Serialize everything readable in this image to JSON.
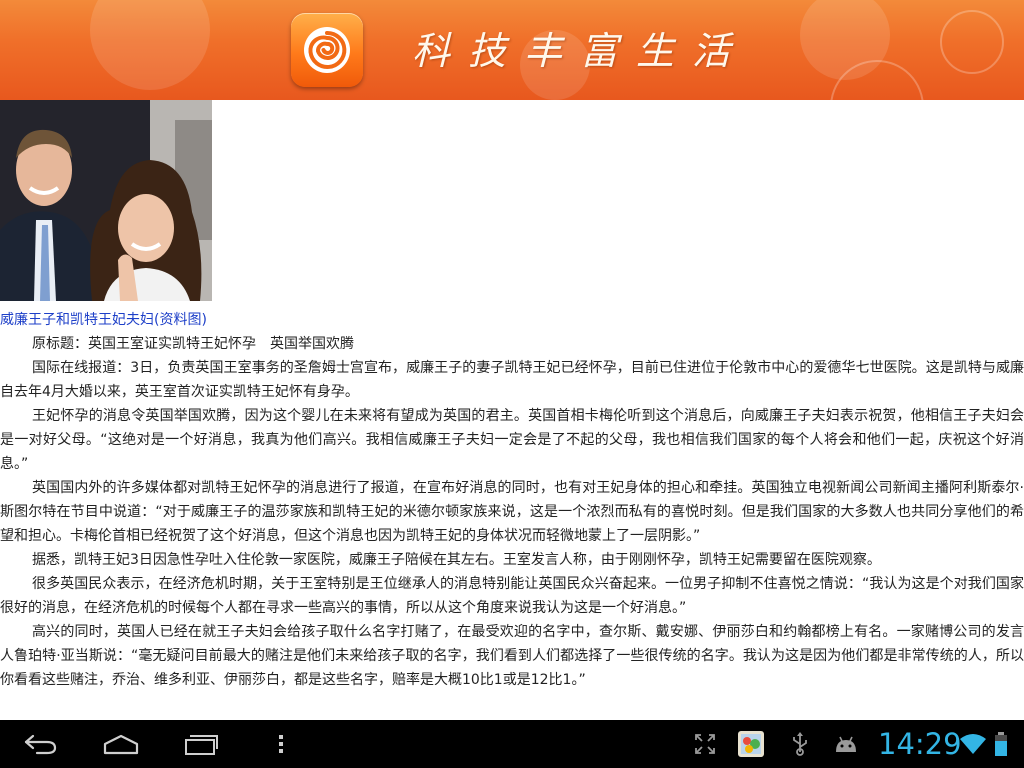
{
  "header": {
    "app_title": "科技丰富生活",
    "icons": {
      "logo": "swirl-logo-icon"
    },
    "colors": {
      "banner": "#f0702a",
      "logo": "#ff7a1a"
    }
  },
  "article": {
    "image_caption": "威廉王子和凯特王妃夫妇(资料图)",
    "paragraphs": [
      "原标题：英国王室证实凯特王妃怀孕　英国举国欢腾",
      "国际在线报道：3日，负责英国王室事务的圣詹姆士宫宣布，威廉王子的妻子凯特王妃已经怀孕，目前已住进位于伦敦市中心的爱德华七世医院。这是凯特与威廉自去年4月大婚以来，英王室首次证实凯特王妃怀有身孕。",
      "王妃怀孕的消息令英国举国欢腾，因为这个婴儿在未来将有望成为英国的君主。英国首相卡梅伦听到这个消息后，向威廉王子夫妇表示祝贺，他相信王子夫妇会是一对好父母。“这绝对是一个好消息，我真为他们高兴。我相信威廉王子夫妇一定会是了不起的父母，我也相信我们国家的每个人将会和他们一起，庆祝这个好消息。”",
      "英国国内外的许多媒体都对凯特王妃怀孕的消息进行了报道，在宣布好消息的同时，也有对王妃身体的担心和牵挂。英国独立电视新闻公司新闻主播阿利斯泰尔·斯图尔特在节目中说道：“对于威廉王子的温莎家族和凯特王妃的米德尔顿家族来说，这是一个浓烈而私有的喜悦时刻。但是我们国家的大多数人也共同分享他们的希望和担心。卡梅伦首相已经祝贺了这个好消息，但这个消息也因为凯特王妃的身体状况而轻微地蒙上了一层阴影。”",
      "据悉，凯特王妃3日因急性孕吐入住伦敦一家医院，威廉王子陪候在其左右。王室发言人称，由于刚刚怀孕，凯特王妃需要留在医院观察。",
      "很多英国民众表示，在经济危机时期，关于王室特别是王位继承人的消息特别能让英国民众兴奋起来。一位男子抑制不住喜悦之情说：“我认为这是个对我们国家很好的消息，在经济危机的时候每个人都在寻求一些高兴的事情，所以从这个角度来说我认为这是一个好消息。”",
      "高兴的同时，英国人已经在就王子夫妇会给孩子取什么名字打赌了，在最受欢迎的名字中，查尔斯、戴安娜、伊丽莎白和约翰都榜上有名。一家赌博公司的发言人鲁珀特·亚当斯说：“毫无疑问目前最大的赌注是他们未来给孩子取的名字，我们看到人们都选择了一些很传统的名字。我认为这是因为他们都是非常传统的人，所以你看看这些赌注，乔治、维多利亚、伊丽莎白，都是这些名字，赔率是大概10比1或是12比1。”"
    ],
    "colors": {
      "caption": "#1d3fc8",
      "text": "#222222"
    }
  },
  "navbar": {
    "clock": "14:29",
    "icons": {
      "back": "back-icon",
      "home": "home-icon",
      "recents": "recent-apps-icon",
      "menu": "overflow-menu-icon",
      "screen_compat": "screen-compat-icon",
      "gallery": "gallery-notification-icon",
      "usb": "usb-icon",
      "android_debug": "android-debug-icon",
      "wifi": "wifi-icon",
      "battery": "battery-icon"
    },
    "colors": {
      "accent": "#33b5e5",
      "bar": "#000000"
    }
  }
}
